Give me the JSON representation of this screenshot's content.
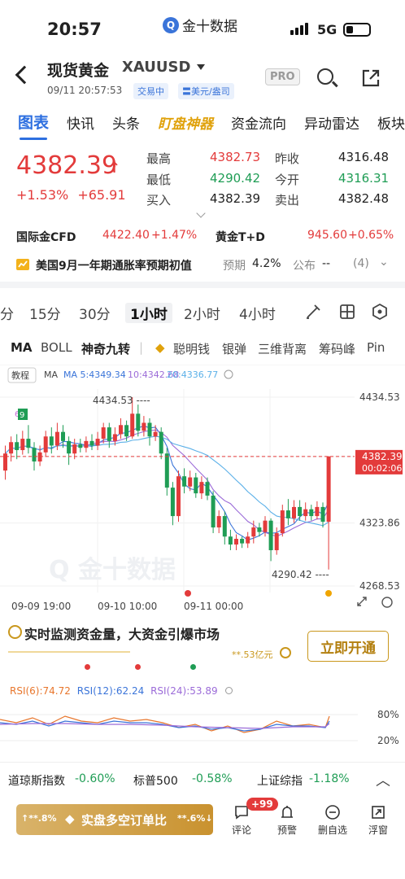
{
  "status_bar": {
    "time": "20:57",
    "app_name": "金十数据",
    "network": "5G"
  },
  "header": {
    "title": "现货黄金",
    "code": "XAUUSD",
    "datetime": "09/11 20:57:53",
    "trading_badge": "交易中",
    "unit_badge": "〓美元/盎司",
    "pro_label": "PRO"
  },
  "tabs": [
    "图表",
    "快讯",
    "头条",
    "盯盘神器",
    "资金流向",
    "异动雷达",
    "板块"
  ],
  "quote": {
    "price": "4382.39",
    "change_pct": "+1.53%",
    "change_abs": "+65.91",
    "high_label": "最高",
    "high": "4382.73",
    "low_label": "最低",
    "low": "4290.42",
    "buy_label": "买入",
    "buy": "4382.39",
    "prev_close_label": "昨收",
    "prev_close": "4316.48",
    "open_label": "今开",
    "open": "4316.31",
    "sell_label": "卖出",
    "sell": "4382.48"
  },
  "cfd_row": {
    "cfd_label": "国际金CFD",
    "cfd_price": "4422.40",
    "cfd_pct": "+1.47%",
    "td_label": "黄金T+D",
    "td_price": "945.60",
    "td_pct": "+0.65%"
  },
  "cpi_row": {
    "text": "美国9月一年期通胀率预期初值",
    "expected_label": "预期",
    "expected": "4.2%",
    "published_label": "公布",
    "published": "--",
    "count": "(4)"
  },
  "intervals": [
    "分",
    "15分",
    "30分",
    "1小时",
    "2小时",
    "4小时"
  ],
  "indicators": [
    "MA",
    "BOLL",
    "神奇九转",
    "聪明钱",
    "银弹",
    "三维背离",
    "筹码峰",
    "Pin"
  ],
  "chart_data": {
    "type": "candlestick",
    "tutorial_label": "教程",
    "ma_legend": {
      "ma5": "MA 5:4349.34",
      "ma10": "10:4342.68",
      "ma20": "20:4336.77"
    },
    "price_axis": [
      "4434.53",
      "4382.39",
      "4323.86",
      "4268.53"
    ],
    "current_time_tag": "00:02:06",
    "x_axis": [
      "09-09 19:00",
      "09-10 10:00",
      "09-11 00:00"
    ],
    "high_annotation": "4434.53",
    "low_annotation": "4290.42",
    "last_price_line": 4382.39,
    "ylim": [
      4268.53,
      4434.53
    ],
    "candles": [
      {
        "o": 4370,
        "c": 4385,
        "h": 4392,
        "l": 4362
      },
      {
        "o": 4385,
        "c": 4395,
        "h": 4400,
        "l": 4378
      },
      {
        "o": 4395,
        "c": 4388,
        "h": 4402,
        "l": 4380
      },
      {
        "o": 4388,
        "c": 4398,
        "h": 4405,
        "l": 4384
      },
      {
        "o": 4398,
        "c": 4390,
        "h": 4410,
        "l": 4385
      },
      {
        "o": 4390,
        "c": 4378,
        "h": 4395,
        "l": 4370
      },
      {
        "o": 4378,
        "c": 4386,
        "h": 4392,
        "l": 4374
      },
      {
        "o": 4386,
        "c": 4400,
        "h": 4405,
        "l": 4382
      },
      {
        "o": 4400,
        "c": 4392,
        "h": 4408,
        "l": 4385
      },
      {
        "o": 4392,
        "c": 4404,
        "h": 4412,
        "l": 4388
      },
      {
        "o": 4404,
        "c": 4396,
        "h": 4410,
        "l": 4390
      },
      {
        "o": 4396,
        "c": 4385,
        "h": 4400,
        "l": 4375
      },
      {
        "o": 4385,
        "c": 4393,
        "h": 4398,
        "l": 4380
      },
      {
        "o": 4393,
        "c": 4390,
        "h": 4398,
        "l": 4386
      },
      {
        "o": 4390,
        "c": 4396,
        "h": 4400,
        "l": 4386
      },
      {
        "o": 4396,
        "c": 4392,
        "h": 4402,
        "l": 4388
      },
      {
        "o": 4392,
        "c": 4398,
        "h": 4404,
        "l": 4388
      },
      {
        "o": 4398,
        "c": 4408,
        "h": 4412,
        "l": 4394
      },
      {
        "o": 4408,
        "c": 4396,
        "h": 4412,
        "l": 4390
      },
      {
        "o": 4396,
        "c": 4402,
        "h": 4408,
        "l": 4392
      },
      {
        "o": 4402,
        "c": 4410,
        "h": 4416,
        "l": 4398
      },
      {
        "o": 4410,
        "c": 4400,
        "h": 4414,
        "l": 4396
      },
      {
        "o": 4400,
        "c": 4420,
        "h": 4434.53,
        "l": 4398
      },
      {
        "o": 4420,
        "c": 4405,
        "h": 4428,
        "l": 4400
      },
      {
        "o": 4405,
        "c": 4412,
        "h": 4418,
        "l": 4400
      },
      {
        "o": 4412,
        "c": 4400,
        "h": 4416,
        "l": 4392
      },
      {
        "o": 4400,
        "c": 4404,
        "h": 4410,
        "l": 4396
      },
      {
        "o": 4404,
        "c": 4385,
        "h": 4408,
        "l": 4380
      },
      {
        "o": 4385,
        "c": 4355,
        "h": 4390,
        "l": 4348
      },
      {
        "o": 4355,
        "c": 4330,
        "h": 4360,
        "l": 4322
      },
      {
        "o": 4330,
        "c": 4365,
        "h": 4370,
        "l": 4325
      },
      {
        "o": 4365,
        "c": 4356,
        "h": 4372,
        "l": 4350
      },
      {
        "o": 4356,
        "c": 4364,
        "h": 4370,
        "l": 4352
      },
      {
        "o": 4364,
        "c": 4350,
        "h": 4368,
        "l": 4346
      },
      {
        "o": 4350,
        "c": 4360,
        "h": 4365,
        "l": 4345
      },
      {
        "o": 4360,
        "c": 4348,
        "h": 4364,
        "l": 4344
      },
      {
        "o": 4348,
        "c": 4320,
        "h": 4352,
        "l": 4315
      },
      {
        "o": 4320,
        "c": 4330,
        "h": 4335,
        "l": 4315
      },
      {
        "o": 4330,
        "c": 4312,
        "h": 4334,
        "l": 4305
      },
      {
        "o": 4312,
        "c": 4305,
        "h": 4318,
        "l": 4300
      },
      {
        "o": 4305,
        "c": 4310,
        "h": 4314,
        "l": 4300
      },
      {
        "o": 4310,
        "c": 4306,
        "h": 4312,
        "l": 4302
      },
      {
        "o": 4306,
        "c": 4312,
        "h": 4316,
        "l": 4302
      },
      {
        "o": 4312,
        "c": 4320,
        "h": 4326,
        "l": 4306
      },
      {
        "o": 4320,
        "c": 4316,
        "h": 4324,
        "l": 4312
      },
      {
        "o": 4316,
        "c": 4326,
        "h": 4330,
        "l": 4312
      },
      {
        "o": 4326,
        "c": 4300,
        "h": 4328,
        "l": 4290.42
      },
      {
        "o": 4300,
        "c": 4315,
        "h": 4320,
        "l": 4296
      },
      {
        "o": 4315,
        "c": 4335,
        "h": 4340,
        "l": 4312
      },
      {
        "o": 4335,
        "c": 4328,
        "h": 4345,
        "l": 4322
      },
      {
        "o": 4328,
        "c": 4338,
        "h": 4344,
        "l": 4324
      },
      {
        "o": 4338,
        "c": 4330,
        "h": 4344,
        "l": 4326
      },
      {
        "o": 4330,
        "c": 4336,
        "h": 4342,
        "l": 4326
      },
      {
        "o": 4336,
        "c": 4330,
        "h": 4340,
        "l": 4326
      },
      {
        "o": 4330,
        "c": 4338,
        "h": 4343,
        "l": 4327
      },
      {
        "o": 4338,
        "c": 4325,
        "h": 4342,
        "l": 4320
      },
      {
        "o": 4325,
        "c": 4382.39,
        "h": 4382.73,
        "l": 4283
      }
    ],
    "colors": {
      "up": "#e33b3b",
      "down": "#1f9d55",
      "ma5": "#3a74d9",
      "ma10": "#9b6bd8",
      "ma20": "#5bb0e8"
    },
    "rsi": {
      "labels": [
        "RSI(6):74.72",
        "RSI(12):62.24",
        "RSI(24):53.89"
      ],
      "levels": [
        "80%",
        "20%"
      ]
    }
  },
  "promo": {
    "text": "实时监测资金量，大资金引爆市场",
    "button": "立即开通",
    "amount": "**.53亿元"
  },
  "index_bar": [
    {
      "name": "道琼斯指数",
      "pct": "-0.60%"
    },
    {
      "name": "标普500",
      "pct": "-0.58%"
    },
    {
      "name": "上证综指",
      "pct": "-1.18%"
    }
  ],
  "bottom_bar": {
    "long_short_button": "实盘多空订单比",
    "left_pct": "**.8%",
    "right_pct": "**.6%",
    "comment_badge": "+99",
    "nav": [
      "评论",
      "预警",
      "删自选",
      "浮窗"
    ]
  }
}
